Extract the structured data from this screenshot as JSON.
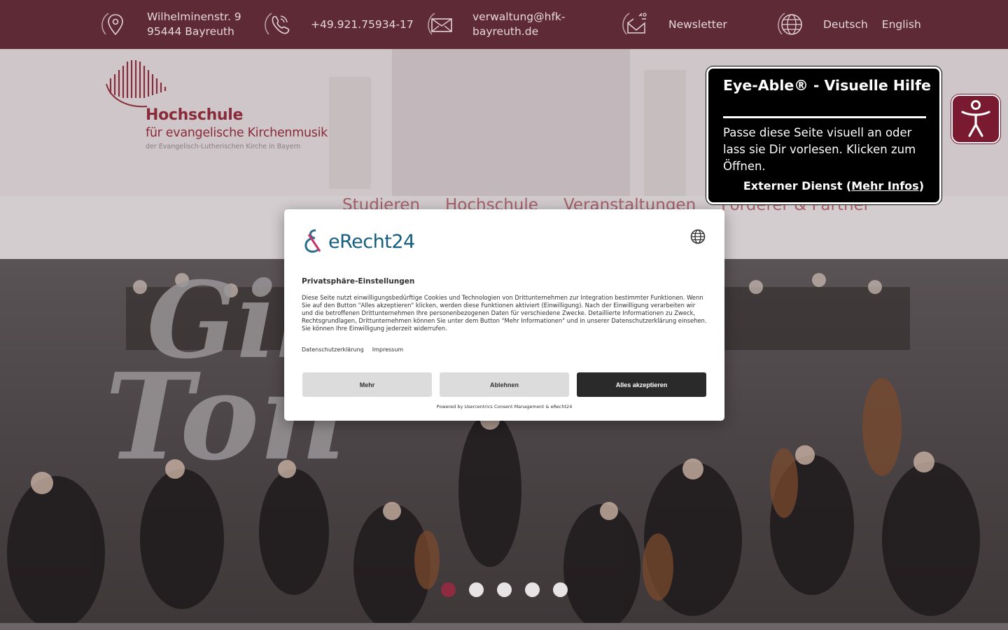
{
  "topbar": {
    "address_line1": "Wilhelminenstr. 9",
    "address_line2": "95444 Bayreuth",
    "phone": "+49.921.75934-17",
    "email_line1": "verwaltung@hfk-",
    "email_line2": "bayreuth.de",
    "newsletter": "Newsletter",
    "lang_de": "Deutsch",
    "lang_en": "English"
  },
  "logo": {
    "title": "Hochschule",
    "subtitle": "für evangelische Kirchenmusik",
    "tagline": "der Evangelisch-Lutherischen Kirche in Bayern"
  },
  "nav": {
    "items": [
      "Studieren",
      "Hochschule",
      "Veranstaltungen",
      "Förderer & Partner"
    ]
  },
  "hero": {
    "slide_count": 5,
    "active_slide": 1
  },
  "consent": {
    "brand": "eRecht24",
    "heading": "Privatsphäre-Einstellungen",
    "body": "Diese Seite nutzt einwilligungsbedürftige Cookies und Technologien von Drittunternehmen zur Integration bestimmter Funktionen. Wenn Sie auf den Button \"Alles akzeptieren\" klicken, werden diese Funktionen aktiviert (Einwilligung). Nach der Einwilligung verarbeiten wir und die betroffenen Drittunternehmen Ihre personenbezogenen Daten für verschiedene Zwecke. Detaillierte Informationen zu Zweck, Rechtsgrundlagen, Drittunternehmen können Sie unter dem Button \"Mehr Informationen\" und in unserer Datenschutzerklärung einsehen. Sie können Ihre Einwilligung jederzeit widerrufen.",
    "link_privacy": "Datenschutzerklärung",
    "link_imprint": "Impressum",
    "btn_more": "Mehr",
    "btn_decline": "Ablehnen",
    "btn_accept": "Alles akzeptieren",
    "powered": "Powered by Usercentrics Consent Management & eRecht24"
  },
  "eyeable": {
    "title": "Eye-Able® - Visuelle Hilfe",
    "body": "Passe diese Seite visuell an oder lass sie Dir vorlesen. Klicken zum Öffnen.",
    "ext_prefix": "Externer Dienst (",
    "ext_link": "Mehr Infos",
    "ext_suffix": ")"
  },
  "colors": {
    "topbar": "#5e2a36",
    "brand": "#8a2b3b",
    "accept_button": "#2a2a2a",
    "active_dot": "#8e2b41"
  }
}
